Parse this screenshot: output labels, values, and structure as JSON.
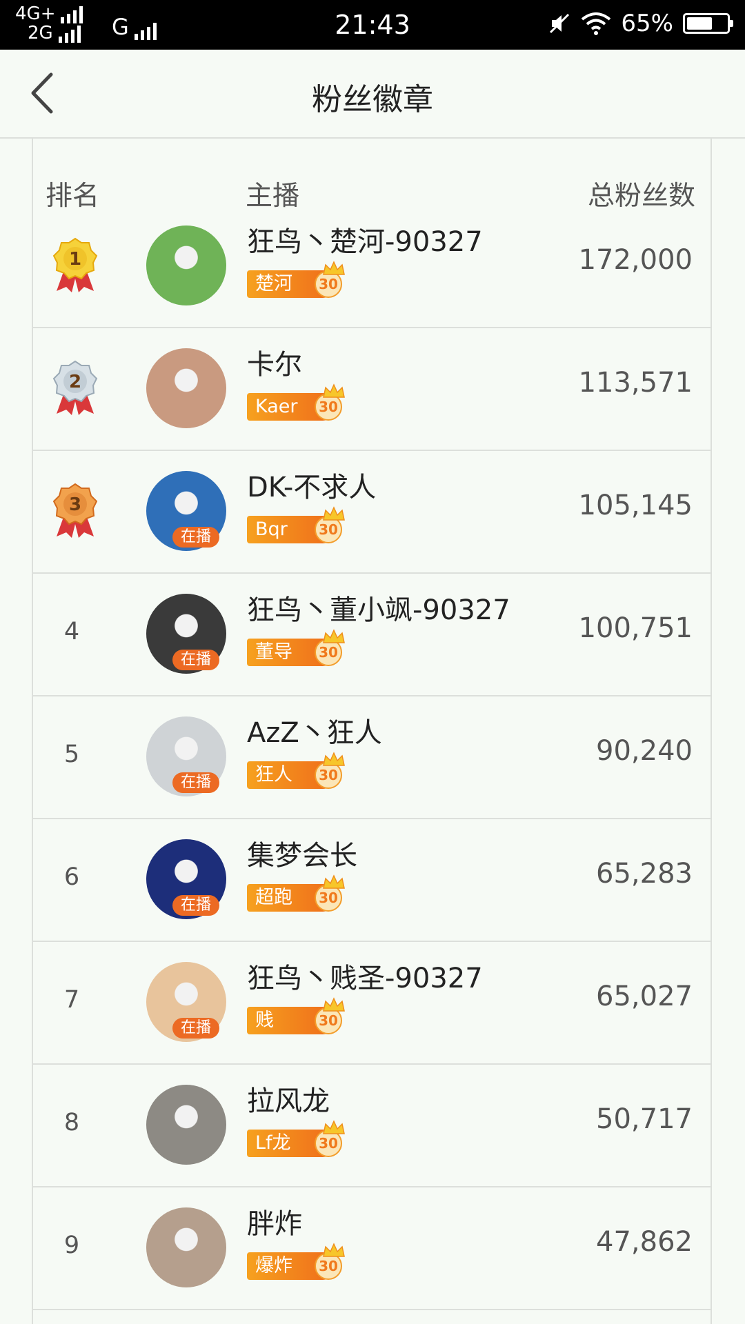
{
  "status_bar": {
    "net1": "4G+",
    "net2": "2G",
    "net3": "G",
    "time": "21:43",
    "battery_percent": "65%",
    "battery_level": 0.65
  },
  "header": {
    "title": "粉丝徽章"
  },
  "columns": {
    "rank": "排名",
    "anchor": "主播",
    "fans": "总粉丝数"
  },
  "colors": {
    "badge_orange": "#ef6b1a",
    "live_tag": "#ec6a23",
    "gold": "#f3c316",
    "silver": "#b7c3cc",
    "bronze": "#e58a2f"
  },
  "live_label": "在播",
  "rows": [
    {
      "rank": "1",
      "medal": "gold",
      "name": "狂鸟丶楚河-90327",
      "badge": "楚河",
      "level": "30",
      "fans": "172,000",
      "live": false,
      "avatar_color": "#6fb357"
    },
    {
      "rank": "2",
      "medal": "silver",
      "name": "卡尔",
      "badge": "Kaer",
      "level": "30",
      "fans": "113,571",
      "live": false,
      "avatar_color": "#c99a80"
    },
    {
      "rank": "3",
      "medal": "bronze",
      "name": "DK-不求人",
      "badge": "Bqr",
      "level": "30",
      "fans": "105,145",
      "live": true,
      "avatar_color": "#2f6fb8"
    },
    {
      "rank": "4",
      "medal": "",
      "name": "狂鸟丶董小飒-90327",
      "badge": "董导",
      "level": "30",
      "fans": "100,751",
      "live": true,
      "avatar_color": "#3a3a3a"
    },
    {
      "rank": "5",
      "medal": "",
      "name": "AzZ丶狂人",
      "badge": "狂人",
      "level": "30",
      "fans": "90,240",
      "live": true,
      "avatar_color": "#cfd3d6"
    },
    {
      "rank": "6",
      "medal": "",
      "name": "集梦会长",
      "badge": "超跑",
      "level": "30",
      "fans": "65,283",
      "live": true,
      "avatar_color": "#1d2e7a"
    },
    {
      "rank": "7",
      "medal": "",
      "name": "狂鸟丶贱圣-90327",
      "badge": "贱",
      "level": "30",
      "fans": "65,027",
      "live": true,
      "avatar_color": "#e8c49c"
    },
    {
      "rank": "8",
      "medal": "",
      "name": "拉风龙",
      "badge": "Lf龙",
      "level": "30",
      "fans": "50,717",
      "live": false,
      "avatar_color": "#8d8a84"
    },
    {
      "rank": "9",
      "medal": "",
      "name": "胖炸",
      "badge": "爆炸",
      "level": "30",
      "fans": "47,862",
      "live": false,
      "avatar_color": "#b59f8d"
    }
  ]
}
